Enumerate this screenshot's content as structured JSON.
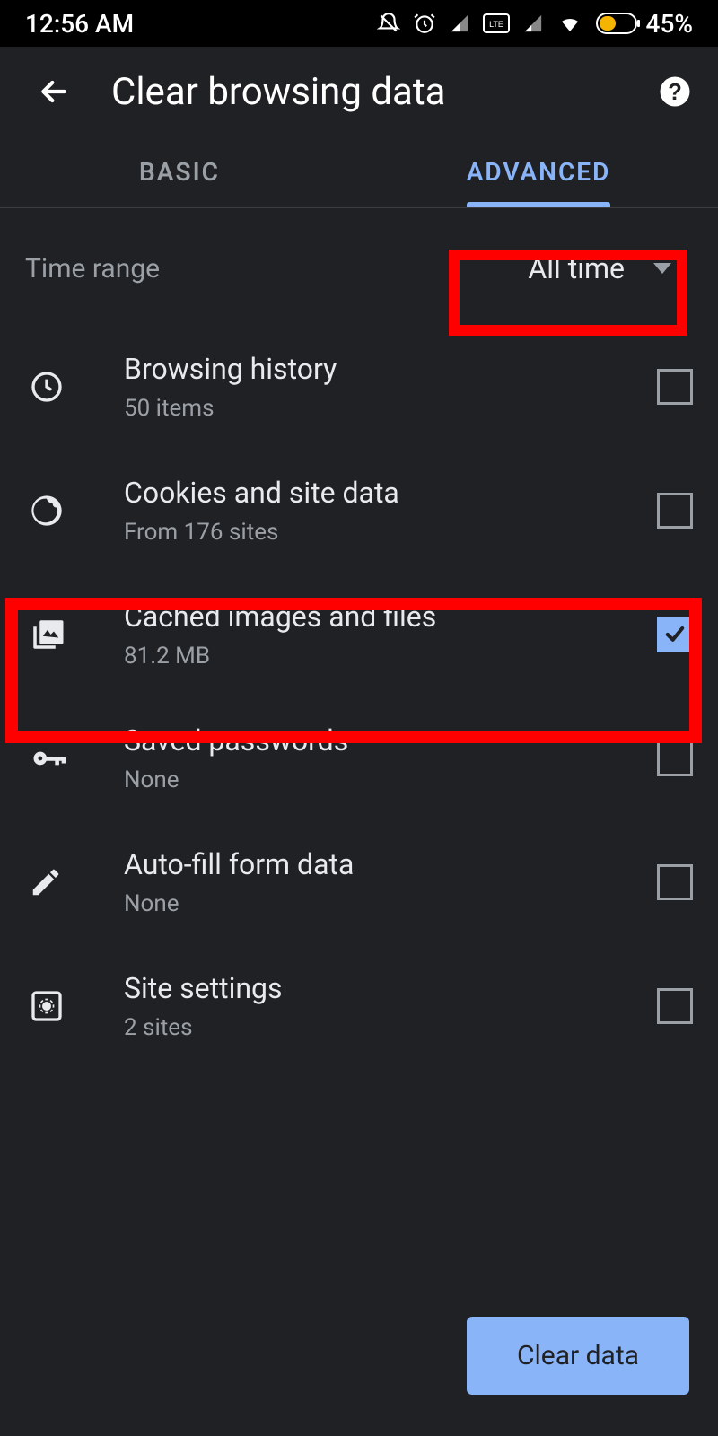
{
  "statusbar": {
    "time": "12:56 AM",
    "battery": "45%"
  },
  "appbar": {
    "title": "Clear browsing data"
  },
  "tabs": {
    "basic": "BASIC",
    "advanced": "ADVANCED"
  },
  "timerange": {
    "label": "Time range",
    "value": "All time"
  },
  "items": [
    {
      "title": "Browsing history",
      "sub": "50 items",
      "checked": false
    },
    {
      "title": "Cookies and site data",
      "sub": "From 176 sites",
      "checked": false
    },
    {
      "title": "Cached images and files",
      "sub": "81.2 MB",
      "checked": true
    },
    {
      "title": "Saved passwords",
      "sub": "None",
      "checked": false
    },
    {
      "title": "Auto-fill form data",
      "sub": "None",
      "checked": false
    },
    {
      "title": "Site settings",
      "sub": "2 sites",
      "checked": false
    }
  ],
  "clear_button": "Clear data"
}
